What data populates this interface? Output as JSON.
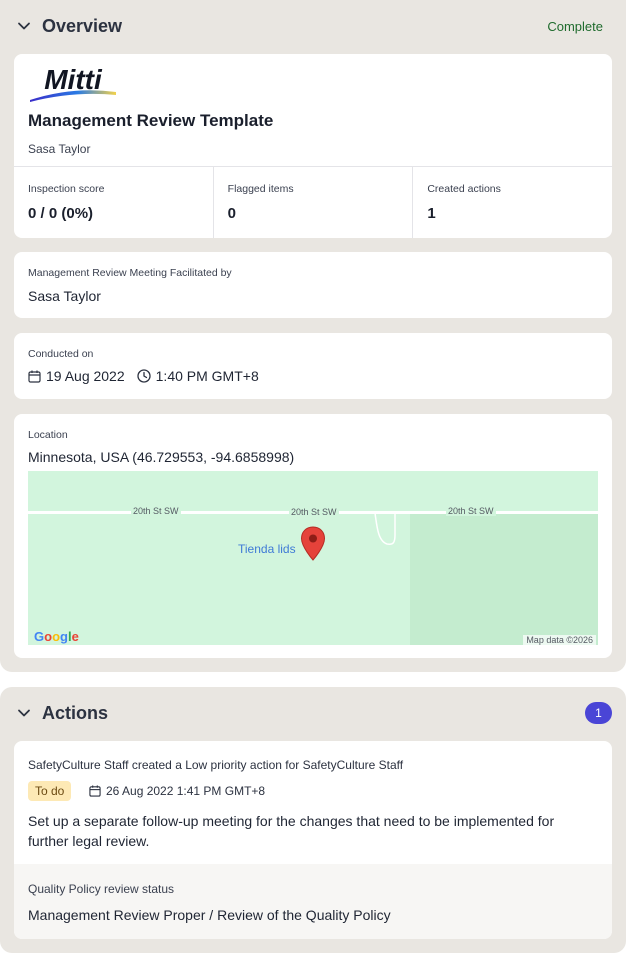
{
  "overview": {
    "title": "Overview",
    "status": "Complete",
    "logo_text": "Mitti",
    "template_title": "Management Review Template",
    "author": "Sasa Taylor",
    "stats": [
      {
        "label": "Inspection score",
        "value": "0 / 0 (0%)"
      },
      {
        "label": "Flagged items",
        "value": "0"
      },
      {
        "label": "Created actions",
        "value": "1"
      }
    ],
    "facilitator": {
      "label": "Management Review Meeting Facilitated by",
      "value": "Sasa Taylor"
    },
    "conducted": {
      "label": "Conducted on",
      "date": "19 Aug 2022",
      "time": "1:40 PM GMT+8"
    },
    "location": {
      "label": "Location",
      "value": "Minnesota, USA (46.729553, -94.6858998)",
      "map": {
        "road_labels": [
          "20th St SW",
          "20th St SW",
          "20th St SW"
        ],
        "poi": "Tienda lids",
        "brand": "Google",
        "attribution": "Map data ©2026"
      }
    }
  },
  "actions": {
    "title": "Actions",
    "count": "1",
    "item": {
      "meta": "SafetyCulture Staff created a Low priority action for SafetyCulture Staff",
      "status": "To do",
      "due": "26 Aug 2022 1:41 PM GMT+8",
      "description": "Set up a separate follow-up meeting for the changes that need to be implemented for further legal review.",
      "source_label": "Quality Policy review status",
      "source_path": "Management Review Proper / Review of the Quality Policy"
    }
  },
  "colors": {
    "section_bg": "#e9e6e1",
    "complete_text": "#1f6b2d",
    "badge_bg": "#4a45d6",
    "todo_bg": "#fde9b5",
    "map_bg": "#d2f5dd",
    "pin": "#e5423a"
  },
  "icons": [
    "chevron-down-icon",
    "calendar-icon",
    "clock-icon",
    "map-pin-icon"
  ]
}
